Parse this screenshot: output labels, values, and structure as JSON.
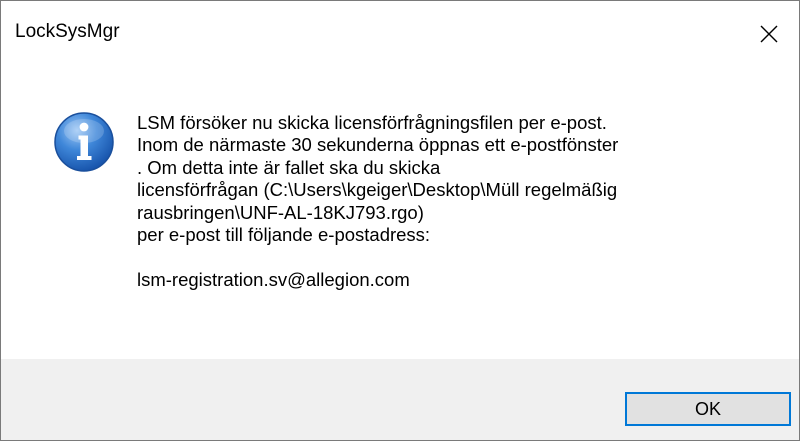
{
  "window": {
    "title": "LockSysMgr",
    "close_icon": "close-icon"
  },
  "dialog": {
    "icon": "info-icon",
    "message_lines": [
      "LSM försöker nu skicka licensförfrågningsfilen per e-post.",
      "Inom de närmaste 30 sekunderna öppnas ett e-postfönster",
      ". Om detta inte är fallet ska du skicka",
      "licensförfrågan (C:\\Users\\kgeiger\\Desktop\\Müll regelmäßig",
      "rausbringen\\UNF-AL-18KJ793.rgo)",
      "per e-post till följande e-postadress:",
      "",
      "lsm-registration.sv@allegion.com"
    ],
    "ok_label": "OK"
  },
  "colors": {
    "accent": "#0078d7",
    "footer_bg": "#f0f0f0",
    "button_bg": "#e1e1e1"
  }
}
